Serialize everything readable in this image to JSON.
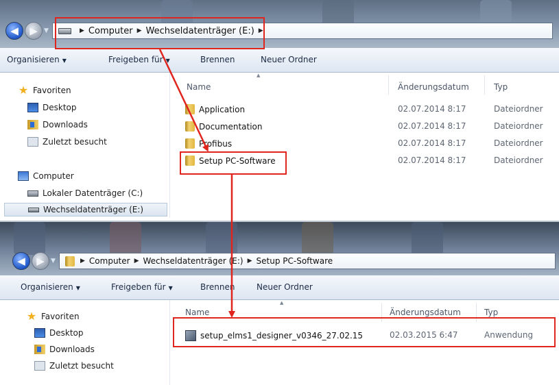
{
  "window_top": {
    "address": {
      "segments": [
        "Computer",
        "Wechseldatenträger (E:)"
      ]
    },
    "toolbar": {
      "organize": "Organisieren",
      "share": "Freigeben für",
      "burn": "Brennen",
      "new_folder": "Neuer Ordner"
    },
    "sidebar": {
      "favorites": "Favoriten",
      "desktop": "Desktop",
      "downloads": "Downloads",
      "recent": "Zuletzt besucht",
      "computer": "Computer",
      "local_disk": "Lokaler Datenträger (C:)",
      "removable": "Wechseldatenträger (E:)"
    },
    "columns": {
      "name": "Name",
      "modified": "Änderungsdatum",
      "type": "Typ"
    },
    "files": [
      {
        "name": "Application",
        "modified": "02.07.2014 8:17",
        "type": "Dateiordner"
      },
      {
        "name": "Documentation",
        "modified": "02.07.2014 8:17",
        "type": "Dateiordner"
      },
      {
        "name": "Profibus",
        "modified": "02.07.2014 8:17",
        "type": "Dateiordner"
      },
      {
        "name": "Setup PC-Software",
        "modified": "02.07.2014 8:17",
        "type": "Dateiordner"
      }
    ]
  },
  "window_bottom": {
    "address": {
      "segments": [
        "Computer",
        "Wechseldatenträger (E:)",
        "Setup PC-Software"
      ]
    },
    "toolbar": {
      "organize": "Organisieren",
      "share": "Freigeben für",
      "burn": "Brennen",
      "new_folder": "Neuer Ordner"
    },
    "sidebar": {
      "favorites": "Favoriten",
      "desktop": "Desktop",
      "downloads": "Downloads",
      "recent": "Zuletzt besucht"
    },
    "columns": {
      "name": "Name",
      "modified": "Änderungsdatum",
      "type": "Typ"
    },
    "files": [
      {
        "name": "setup_elms1_designer_v0346_27.02.15",
        "modified": "02.03.2015 6:47",
        "type": "Anwendung"
      }
    ]
  },
  "annotation_color": "#e0251f"
}
